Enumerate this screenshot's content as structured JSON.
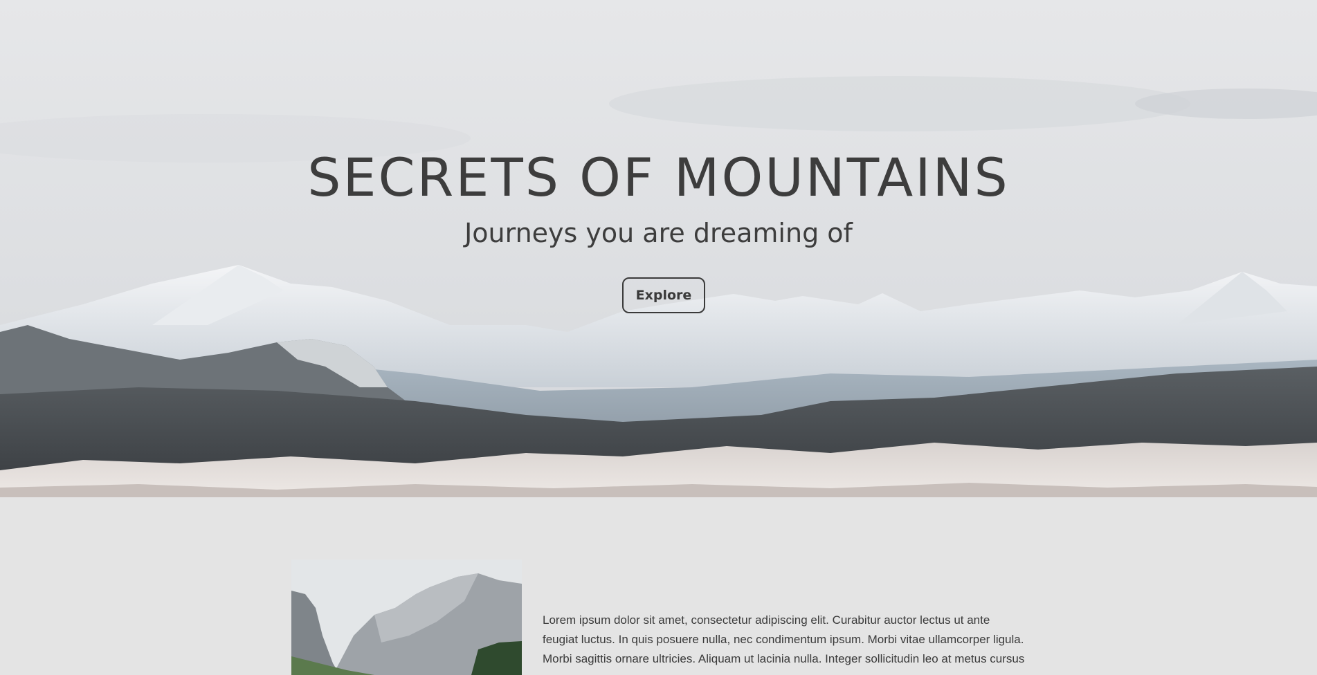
{
  "hero": {
    "title": "SECRETS OF MOUNTAINS",
    "subtitle": "Journeys you are dreaming of",
    "button_label": "Explore"
  },
  "content": {
    "paragraph": "Lorem ipsum dolor sit amet, consectetur adipiscing elit. Curabitur auctor lectus ut ante feugiat luctus. In quis posuere nulla, nec condimentum ipsum. Morbi vitae ullamcorper ligula. Morbi sagittis ornare ultricies. Aliquam ut lacinia nulla. Integer sollicitudin leo at metus cursus"
  },
  "colors": {
    "background": "#e4e4e4",
    "text": "#3d3d3d",
    "sky": "#e2e3e5"
  }
}
